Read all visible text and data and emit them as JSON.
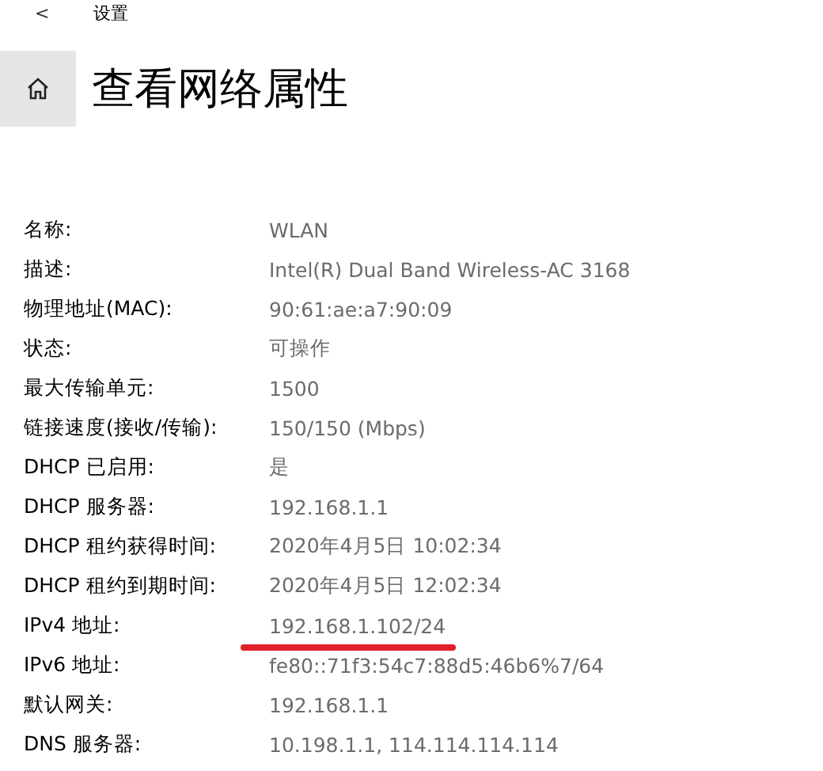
{
  "nav": {
    "back": "<",
    "title": "设置"
  },
  "page": {
    "title": "查看网络属性"
  },
  "properties": [
    {
      "label": "名称:",
      "value": "WLAN",
      "underlined": false
    },
    {
      "label": "描述:",
      "value": "Intel(R) Dual Band Wireless-AC 3168",
      "underlined": false
    },
    {
      "label": "物理地址(MAC):",
      "value": "90:61:ae:a7:90:09",
      "underlined": false
    },
    {
      "label": "状态:",
      "value": "可操作",
      "underlined": false
    },
    {
      "label": "最大传输单元:",
      "value": "1500",
      "underlined": false
    },
    {
      "label": "链接速度(接收/传输):",
      "value": "150/150 (Mbps)",
      "underlined": false
    },
    {
      "label": "DHCP 已启用:",
      "value": "是",
      "underlined": false
    },
    {
      "label": "DHCP 服务器:",
      "value": "192.168.1.1",
      "underlined": false
    },
    {
      "label": "DHCP 租约获得时间:",
      "value": "2020年4月5日 10:02:34",
      "underlined": false
    },
    {
      "label": "DHCP 租约到期时间:",
      "value": "2020年4月5日 12:02:34",
      "underlined": false
    },
    {
      "label": "IPv4 地址:",
      "value": "192.168.1.102/24",
      "underlined": true
    },
    {
      "label": "IPv6 地址:",
      "value": "fe80::71f3:54c7:88d5:46b6%7/64",
      "underlined": false
    },
    {
      "label": "默认网关:",
      "value": "192.168.1.1",
      "underlined": false
    },
    {
      "label": "DNS 服务器:",
      "value": "10.198.1.1, 114.114.114.114",
      "underlined": false
    }
  ]
}
